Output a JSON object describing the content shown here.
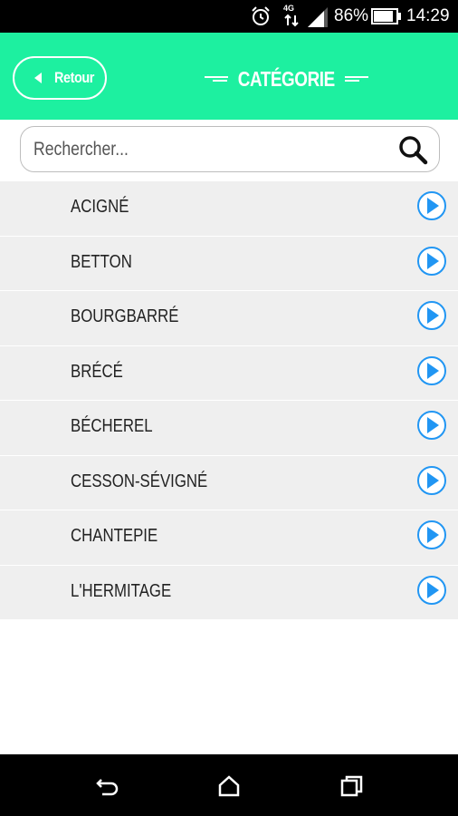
{
  "status_bar": {
    "network_label": "4G",
    "battery_percent": "86%",
    "time": "14:29",
    "icons": [
      "alarm-icon",
      "network-4g-icon",
      "signal-icon",
      "battery-icon"
    ]
  },
  "header": {
    "back_label": "Retour",
    "title": "CATÉGORIE",
    "background_color": "#1df0a0"
  },
  "search": {
    "placeholder": "Rechercher...",
    "value": "",
    "icon": "search-icon"
  },
  "list": {
    "items": [
      {
        "label": "ACIGNÉ"
      },
      {
        "label": "BETTON"
      },
      {
        "label": "BOURGBARRÉ"
      },
      {
        "label": "BRÉCÉ"
      },
      {
        "label": "BÉCHEREL"
      },
      {
        "label": "CESSON-SÉVIGNÉ"
      },
      {
        "label": "CHANTEPIE"
      },
      {
        "label": "L'HERMITAGE"
      }
    ],
    "item_icon": "play-circle-icon",
    "accent_color": "#2196f3"
  },
  "nav_bar": {
    "buttons": [
      "back-nav-icon",
      "home-nav-icon",
      "recents-nav-icon"
    ]
  }
}
